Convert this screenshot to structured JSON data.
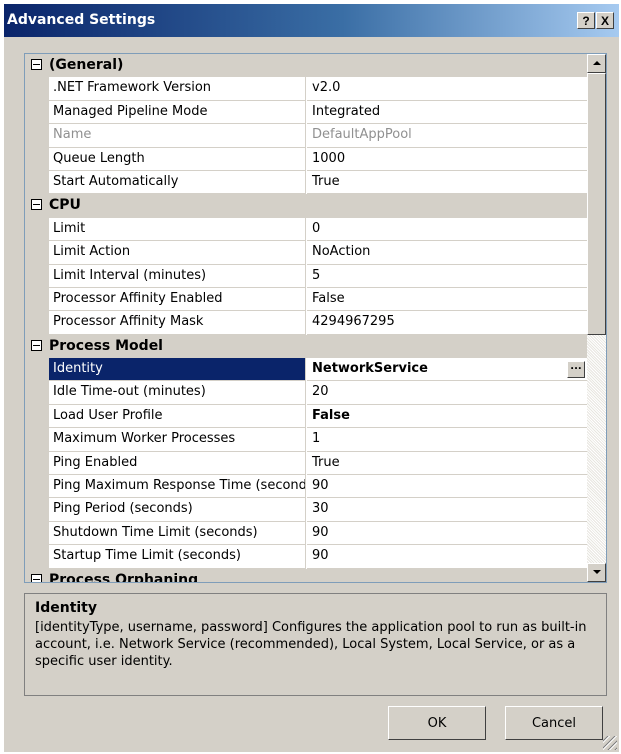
{
  "window": {
    "title": "Advanced Settings",
    "help_label": "?",
    "close_label": "X"
  },
  "grid": {
    "categories": [
      {
        "label": "(General)",
        "rows": [
          {
            "name": ".NET Framework Version",
            "value": "v2.0"
          },
          {
            "name": "Managed Pipeline Mode",
            "value": "Integrated"
          },
          {
            "name": "Name",
            "value": "DefaultAppPool",
            "disabled": true
          },
          {
            "name": "Queue Length",
            "value": "1000"
          },
          {
            "name": "Start Automatically",
            "value": "True"
          }
        ]
      },
      {
        "label": "CPU",
        "rows": [
          {
            "name": "Limit",
            "value": "0"
          },
          {
            "name": "Limit Action",
            "value": "NoAction"
          },
          {
            "name": "Limit Interval (minutes)",
            "value": "5"
          },
          {
            "name": "Processor Affinity Enabled",
            "value": "False"
          },
          {
            "name": "Processor Affinity Mask",
            "value": "4294967295"
          }
        ]
      },
      {
        "label": "Process Model",
        "rows": [
          {
            "name": "Identity",
            "value": "NetworkService",
            "selected": true,
            "has_button": true,
            "button_label": "..."
          },
          {
            "name": "Idle Time-out (minutes)",
            "value": "20"
          },
          {
            "name": "Load User Profile",
            "value": "False",
            "bold": true
          },
          {
            "name": "Maximum Worker Processes",
            "value": "1"
          },
          {
            "name": "Ping Enabled",
            "value": "True"
          },
          {
            "name": "Ping Maximum Response Time (seconds)",
            "value": "90"
          },
          {
            "name": "Ping Period (seconds)",
            "value": "30"
          },
          {
            "name": "Shutdown Time Limit (seconds)",
            "value": "90"
          },
          {
            "name": "Startup Time Limit (seconds)",
            "value": "90"
          }
        ]
      },
      {
        "label": "Process Orphaning",
        "rows": []
      }
    ]
  },
  "description": {
    "title": "Identity",
    "text": "[identityType, username, password] Configures the application pool to run as built-in account, i.e. Network Service (recommended), Local System, Local Service, or as a specific user identity."
  },
  "buttons": {
    "ok": "OK",
    "cancel": "Cancel"
  }
}
